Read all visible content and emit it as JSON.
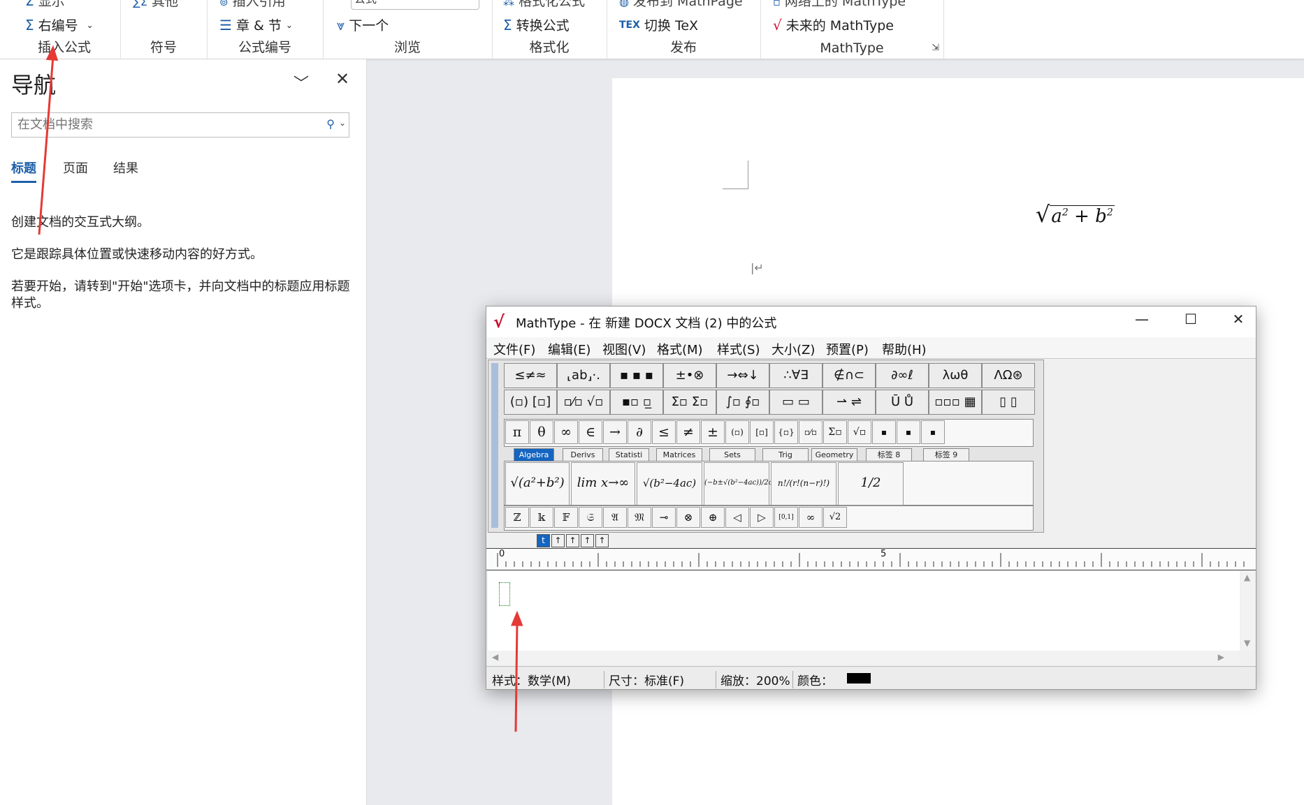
{
  "ribbon": {
    "groups": [
      {
        "label": "插入公式",
        "items": [
          {
            "icon": "sigma-icon",
            "label": "右编号"
          }
        ],
        "partial": "显示"
      },
      {
        "label": "符号",
        "partial": "其他"
      },
      {
        "label": "公式编号",
        "items": [
          {
            "icon": "list-icon",
            "label": "章 & 节"
          }
        ],
        "partial": "插入引用"
      },
      {
        "label": "浏览",
        "items": [
          {
            "icon": "filter-down-icon",
            "label": "下一个"
          }
        ],
        "partial": "公式"
      },
      {
        "label": "格式化",
        "items": [
          {
            "icon": "sigma-convert-icon",
            "label": "转换公式"
          }
        ],
        "partial": "格式化公式"
      },
      {
        "label": "发布",
        "items": [
          {
            "icon": "tex-icon",
            "label": "切换 TeX"
          }
        ],
        "partial": "发布到 MathPage"
      },
      {
        "label": "MathType",
        "items": [
          {
            "icon": "mathtype-future-icon",
            "label": "未来的 MathType"
          }
        ],
        "partial": "网络上的 MathType"
      }
    ]
  },
  "nav": {
    "title": "导航",
    "search_placeholder": "在文档中搜索",
    "tabs": [
      "标题",
      "页面",
      "结果"
    ],
    "active_tab": "标题",
    "paragraphs": [
      "创建文档的交互式大纲。",
      "它是跟踪具体位置或快速移动内容的好方式。",
      "若要开始，请转到\"开始\"选项卡，并向文档中的标题应用标题样式。"
    ]
  },
  "document": {
    "equation": {
      "radicand_a": "a",
      "radicand_b": "b",
      "exp": "2",
      "plus": "+"
    }
  },
  "mathtype": {
    "title": "MathType - 在 新建 DOCX 文档 (2) 中的公式",
    "menus": [
      "文件(F)",
      "编辑(E)",
      "视图(V)",
      "格式(M)",
      "样式(S)",
      "大小(Z)",
      "预置(P)",
      "帮助(H)"
    ],
    "palette_row1": [
      "≤≠≈",
      "⸤ab⸥·.",
      "▪ ▪ ▪",
      "±•⊗",
      "→⇔↓",
      "∴∀∃",
      "∉∩⊂",
      "∂∞ℓ",
      "λωθ",
      "ΛΩ⊛"
    ],
    "palette_row2": [
      "(▫) [▫]",
      "▫⁄▫ √▫",
      "▪▫ ▫̲",
      "Σ▫ Σ▫",
      "∫▫ ∮▫",
      "▭ ▭",
      "⇀ ⇌",
      "Ū Ů",
      "▫▫▫ ▦",
      "▯ ▯"
    ],
    "symbol_row": [
      "π",
      "θ",
      "∞",
      "∈",
      "→",
      "∂",
      "≤",
      "≠",
      "±",
      "(▫)",
      "[▫]",
      "{▫}",
      "▫⁄▫",
      "Σ▫",
      "√▫",
      "▪",
      "▪",
      "▪"
    ],
    "tabs": [
      "Algebra",
      "Derivs",
      "Statisti",
      "Matrices",
      "Sets",
      "Trig",
      "Geometry",
      "标签 8",
      "标签 9"
    ],
    "active_tab": "Algebra",
    "templates": [
      "√(a²+b²)",
      "lim x→∞",
      "√(b²−4ac)",
      "(−b±√(b²−4ac))/2a",
      "n!/(r!(n−r)!)",
      "1/2"
    ],
    "symbol_row2": [
      "ℤ",
      "𝕜",
      "𝔽",
      "𝔖",
      "𝔄",
      "𝔐",
      "⊸",
      "⊗",
      "⊕",
      "◁",
      "▷",
      "[0,1]",
      "∞",
      "√2"
    ],
    "nudge": [
      "t",
      "↑",
      "↑",
      "↑",
      "↑"
    ],
    "ruler": {
      "start": "0",
      "mid": "5"
    },
    "status": {
      "style_label": "样式：",
      "style_value": "数学(M)",
      "size_label": "尺寸：",
      "size_value": "标准(F)",
      "zoom_label": "缩放：",
      "zoom_value": "200%",
      "color_label": "颜色："
    },
    "colors": {
      "swatch": "#000000"
    }
  },
  "annotation_colors": {
    "arrow": "#e53935"
  }
}
